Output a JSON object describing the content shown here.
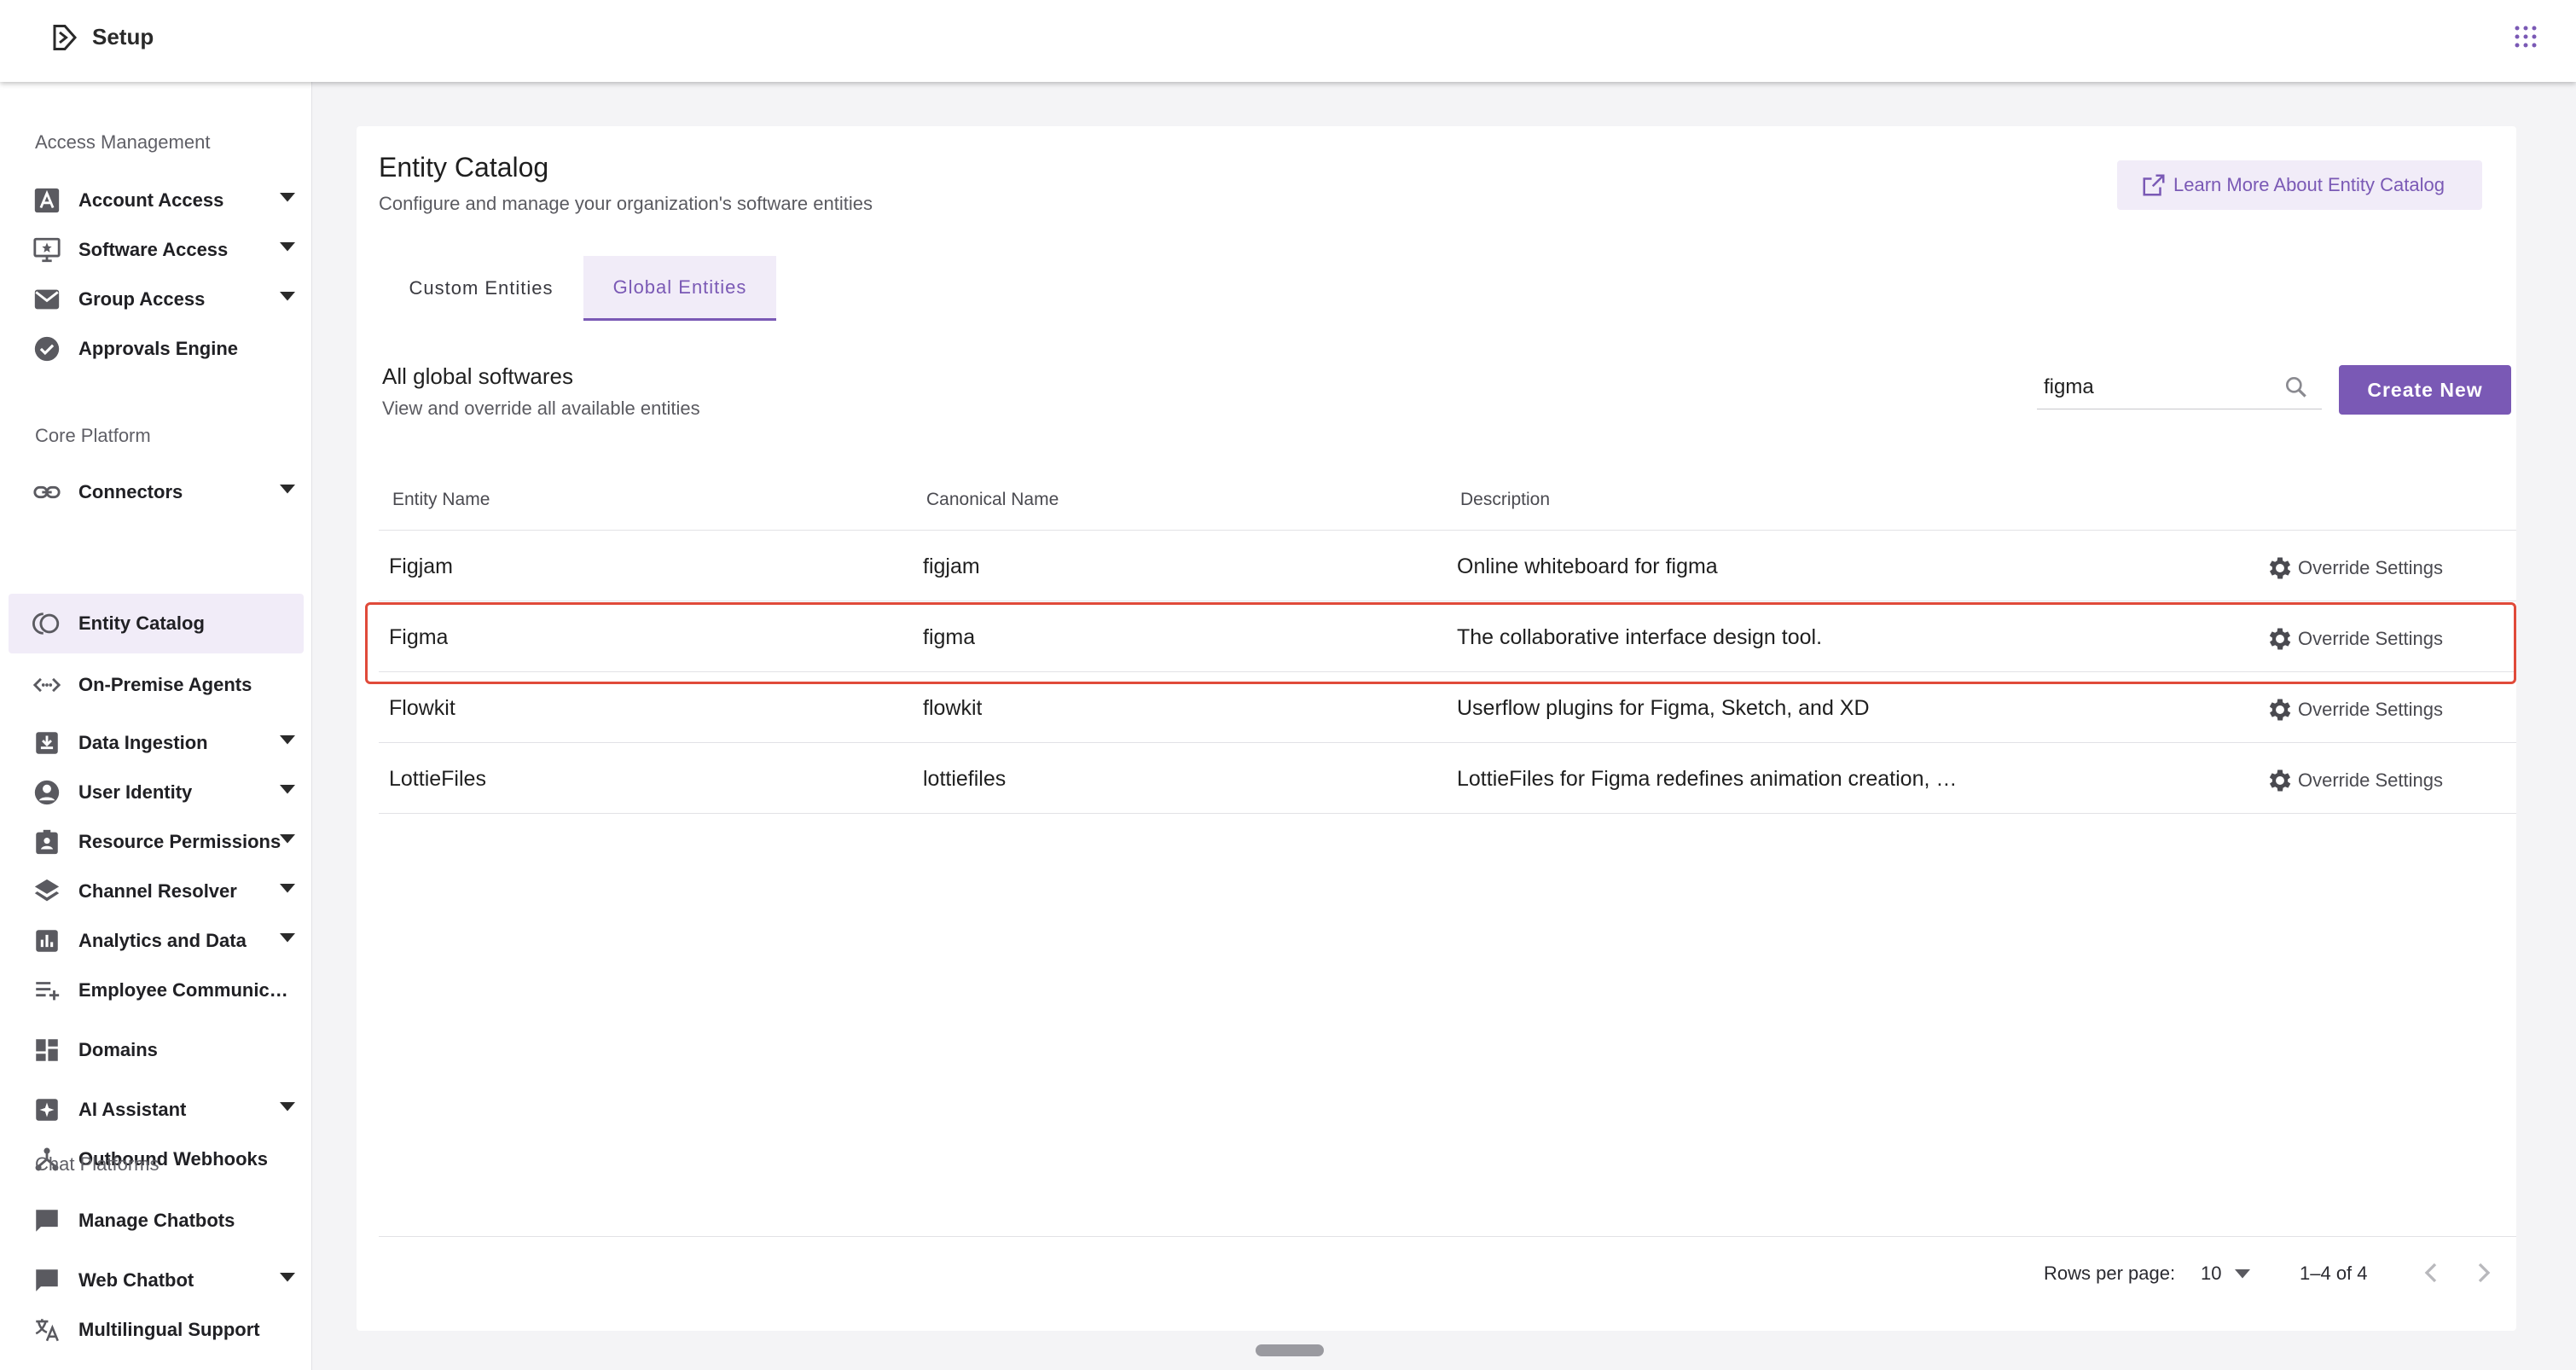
{
  "header": {
    "app_title": "Setup",
    "logo_icon": "setup-logo-icon",
    "apps_icon": "apps-grid-icon"
  },
  "sidebar": {
    "sections": [
      {
        "title": "Access Management",
        "items": [
          {
            "label": "Account Access",
            "icon": "account-icon",
            "expandable": true
          },
          {
            "label": "Software Access",
            "icon": "software-icon",
            "expandable": true
          },
          {
            "label": "Group Access",
            "icon": "mail-icon",
            "expandable": true
          },
          {
            "label": "Approvals Engine",
            "icon": "check-circle-icon",
            "expandable": false
          }
        ]
      },
      {
        "title": "Core Platform",
        "items": [
          {
            "label": "Connectors",
            "icon": "link-icon",
            "expandable": true
          },
          {
            "label": "Entity Catalog",
            "icon": "catalog-icon",
            "expandable": false,
            "active": true
          },
          {
            "label": "On-Premise Agents",
            "icon": "code-icon",
            "expandable": false
          },
          {
            "label": "Data Ingestion",
            "icon": "download-box-icon",
            "expandable": true
          },
          {
            "label": "User Identity",
            "icon": "person-icon",
            "expandable": true
          },
          {
            "label": "Resource Permissions",
            "icon": "badge-icon",
            "expandable": true
          },
          {
            "label": "Channel Resolver",
            "icon": "layers-icon",
            "expandable": true
          },
          {
            "label": "Analytics and Data",
            "icon": "bar-chart-icon",
            "expandable": true
          },
          {
            "label": "Employee Communic…",
            "icon": "playlist-add-icon",
            "expandable": false
          },
          {
            "label": "Domains",
            "icon": "dashboard-icon",
            "expandable": false
          },
          {
            "label": "AI Assistant",
            "icon": "sparkle-icon",
            "expandable": true
          },
          {
            "label": "Outbound Webhooks",
            "icon": "webhook-icon",
            "expandable": false
          }
        ]
      },
      {
        "title": "Chat Platforms",
        "items": [
          {
            "label": "Manage Chatbots",
            "icon": "chat-icon",
            "expandable": false
          },
          {
            "label": "Web Chatbot",
            "icon": "chat-bubble-icon",
            "expandable": true
          },
          {
            "label": "Multilingual Support",
            "icon": "translate-icon",
            "expandable": false
          }
        ]
      }
    ]
  },
  "main": {
    "title": "Entity Catalog",
    "subtitle": "Configure and manage your organization's software entities",
    "learn_more_label": "Learn More About Entity Catalog",
    "tabs": [
      {
        "label": "Custom Entities",
        "active": false
      },
      {
        "label": "Global Entities",
        "active": true
      }
    ],
    "list_title": "All global softwares",
    "list_subtitle": "View and override all available entities",
    "search": {
      "value": "figma",
      "placeholder": "Search"
    },
    "create_label": "Create New",
    "table": {
      "columns": [
        "Entity Name",
        "Canonical Name",
        "Description"
      ],
      "action_label": "Override Settings",
      "rows": [
        {
          "entity": "Figjam",
          "canonical": "figjam",
          "description": "Online whiteboard for figma"
        },
        {
          "entity": "Figma",
          "canonical": "figma",
          "description": "The collaborative interface design tool.",
          "highlighted": true
        },
        {
          "entity": "Flowkit",
          "canonical": "flowkit",
          "description": "Userflow plugins for Figma, Sketch, and XD"
        },
        {
          "entity": "LottieFiles",
          "canonical": "lottiefiles",
          "description": "LottieFiles for Figma redefines animation creation, …"
        }
      ]
    },
    "pagination": {
      "rows_per_page_label": "Rows per page:",
      "rows_per_page": "10",
      "range": "1–4 of 4"
    }
  },
  "colors": {
    "accent": "#7a59b5",
    "accent_light": "#f1ecf8",
    "highlight_border": "#e04a3a"
  }
}
